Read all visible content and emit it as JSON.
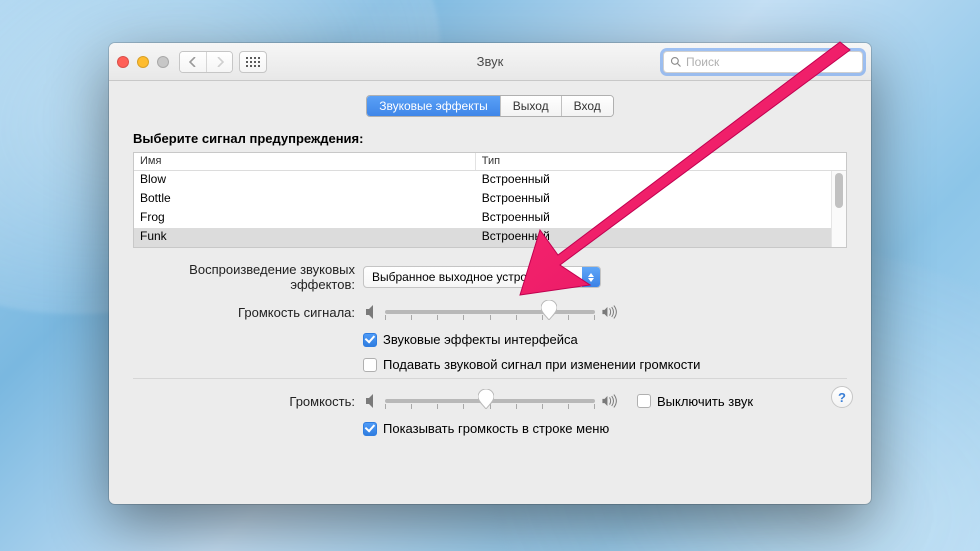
{
  "window": {
    "title": "Звук"
  },
  "search": {
    "placeholder": "Поиск"
  },
  "tabs": {
    "effects": "Звуковые эффекты",
    "output": "Выход",
    "input": "Вход"
  },
  "section": {
    "choose_alert": "Выберите сигнал предупреждения:"
  },
  "table": {
    "col_name": "Имя",
    "col_type": "Тип",
    "rows": [
      {
        "name": "Blow",
        "type": "Встроенный"
      },
      {
        "name": "Bottle",
        "type": "Встроенный"
      },
      {
        "name": "Frog",
        "type": "Встроенный"
      },
      {
        "name": "Funk",
        "type": "Встроенный"
      }
    ]
  },
  "play_through": {
    "label": "Воспроизведение звуковых эффектов:",
    "value": "Выбранное выходное устройство"
  },
  "alert_volume": {
    "label": "Громкость сигнала:"
  },
  "ui_sounds": {
    "label": "Звуковые эффекты интерфейса"
  },
  "feedback": {
    "label": "Подавать звуковой сигнал при изменении громкости"
  },
  "output_volume": {
    "label": "Громкость:"
  },
  "mute": {
    "label": "Выключить звук"
  },
  "menubar": {
    "label": "Показывать громкость в строке меню"
  },
  "help": {
    "glyph": "?"
  }
}
